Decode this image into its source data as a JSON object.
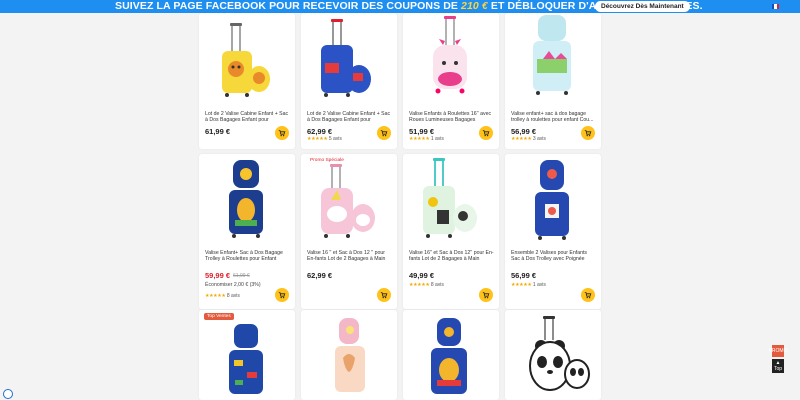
{
  "banner": {
    "text_before": "SUIVEZ LA PAGE FACEBOOK POUR RECEVOIR DES COUPONS DE",
    "amount": "210 €",
    "text_after": "ET DÉBLOQUER D'AUTRES AVANTAGES.",
    "button": "Découvrez Dès Maintenant"
  },
  "products": [
    {
      "title": "Lot de 2 Valise Cabine Enfant + Sac à Dos Bagages Enfant pour Garçons...",
      "price": "61,99 €"
    },
    {
      "title": "Lot de 2 Valise Cabine Enfant + Sac à Dos Bagages Enfant pour Garçons...",
      "price": "62,99 €",
      "reviews": "5 avis"
    },
    {
      "title": "Valise Enfants à Roulettes 16'' avec Roues Lumineuses Bagages Enfant...",
      "price": "51,99 €",
      "reviews": "1 avis"
    },
    {
      "title": "Valise enfant+ sac à dos bagage trolley à roulettes pour enfant Cou...",
      "price": "56,99 €",
      "reviews": "3 avis"
    },
    {
      "title": "Valise Enfant+ Sac à Dos Bagage Trolley à Roulettes pour Enfant Moti...",
      "price": "59,99 €",
      "old_price": "61,99 €",
      "saving": "Économiser 2,00 € (3%)",
      "reviews": "8 avis"
    },
    {
      "title": "Valise 16 '' et Sac à Dos 12 '' pour En-fants Lot de 2 Bagages à Main avec...",
      "price": "62,99 €",
      "badge": "Promo Spéciale"
    },
    {
      "title": "Valise 16'' et Sac à Dos 12'' pour En-fants Lot de 2 Bagages à Main avec...",
      "price": "49,99 €",
      "reviews": "8 avis"
    },
    {
      "title": "Ensemble 2 Valises pour Enfants Sac à Dos Trolley avec Poignée Rétrac...",
      "price": "56,99 €",
      "reviews": "1 avis"
    },
    {
      "badge": "Top Ventes"
    },
    {},
    {},
    {}
  ],
  "stars": "★★★★★",
  "side": {
    "promo": "PROMO",
    "top": "Top"
  },
  "colors": {
    "banner": "#1e8ff0",
    "accent": "#ffd33d",
    "cart": "#ffc21a",
    "sale": "#e0202a"
  }
}
